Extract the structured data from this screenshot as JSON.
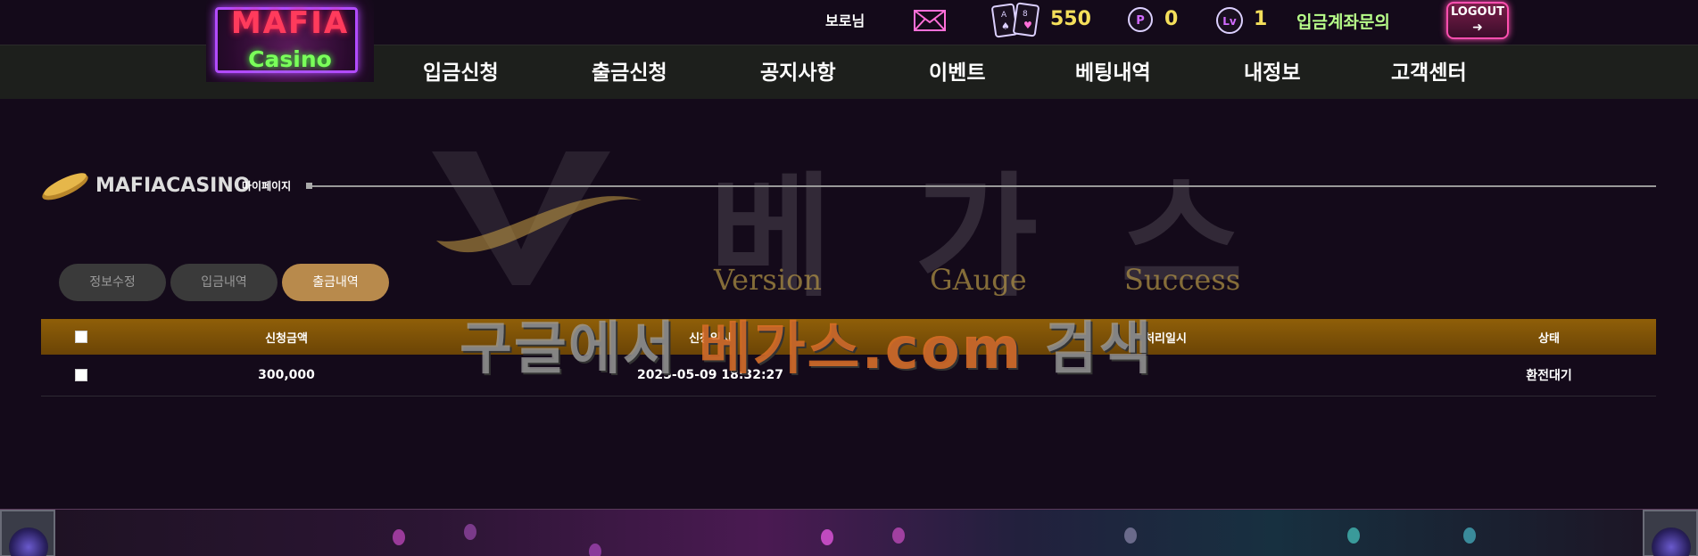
{
  "logo": {
    "top": "MAFIA",
    "bottom": "Casino"
  },
  "header": {
    "user_name": "보로님",
    "money": "550",
    "points": "0",
    "level": "1",
    "deposit_inquiry": "입금계좌문의",
    "logout": "LOGOUT"
  },
  "nav": [
    {
      "label": "입금신청"
    },
    {
      "label": "출금신청"
    },
    {
      "label": "공지사항"
    },
    {
      "label": "이벤트"
    },
    {
      "label": "베팅내역"
    },
    {
      "label": "내정보"
    },
    {
      "label": "고객센터"
    }
  ],
  "watermark": {
    "title": "베 가 스",
    "sub1": "Version",
    "sub2": "GAuge",
    "sub3": "Success",
    "search_before": "구글에서 ",
    "search_highlight": "베가스.com",
    "search_after": " 검색"
  },
  "section": {
    "title": "MAFIACASINO",
    "subtitle": "마이페이지"
  },
  "tabs": [
    {
      "label": "정보수정",
      "active": false
    },
    {
      "label": "입금내역",
      "active": false
    },
    {
      "label": "출금내역",
      "active": true
    }
  ],
  "table": {
    "headers": {
      "amount": "신청금액",
      "date": "신청일시",
      "processed": "처리일시",
      "status": "상태"
    },
    "rows": [
      {
        "amount": "300,000",
        "date": "2025-05-09 18:32:27",
        "processed": "",
        "status": "환전대기"
      }
    ]
  },
  "colors": {
    "background": "#140a1a",
    "navbar": "#1d1f1c",
    "accent_gold": "#b88a4c",
    "table_header": "#8f5f08",
    "money_yellow": "#f4df5b"
  }
}
